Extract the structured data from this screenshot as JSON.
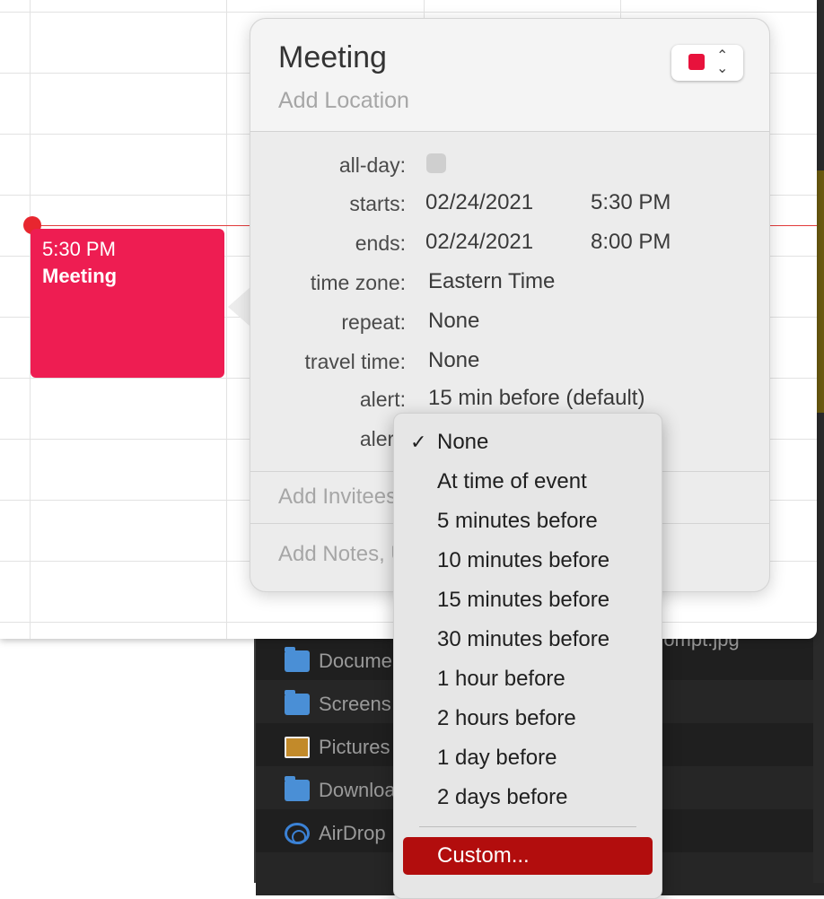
{
  "finder": {
    "sidebar": [
      {
        "label": "Docume",
        "icon": "folder-documents-icon"
      },
      {
        "label": "Screens",
        "icon": "folder-icon"
      },
      {
        "label": "Pictures",
        "icon": "pictures-icon"
      },
      {
        "label": "Downloa",
        "icon": "downloads-icon"
      },
      {
        "label": "AirDrop",
        "icon": "airdrop-icon"
      }
    ],
    "file_name": "rompt.jpg"
  },
  "calendar": {
    "event": {
      "time": "5:30 PM",
      "name": "Meeting",
      "color": "#ee1d52"
    }
  },
  "popover": {
    "title": "Meeting",
    "location_placeholder": "Add Location",
    "calendar_color": "#e8123c",
    "fields": {
      "allday_label": "all-day:",
      "starts_label": "starts:",
      "starts_date": "02/24/2021",
      "starts_time": "5:30 PM",
      "ends_label": "ends:",
      "ends_date": "02/24/2021",
      "ends_time": "8:00 PM",
      "timezone_label": "time zone:",
      "timezone_value": "Eastern Time",
      "repeat_label": "repeat:",
      "repeat_value": "None",
      "travel_label": "travel time:",
      "travel_value": "None",
      "alert_label": "alert:",
      "alert_value": "15 min before (default)",
      "alert2_label": "alert:"
    },
    "add_invitees": "Add Invitees",
    "add_notes": "Add Notes, URL, or Attachments"
  },
  "alert_menu": {
    "items": [
      {
        "label": "None",
        "checked": true
      },
      {
        "label": "At time of event"
      },
      {
        "label": "5 minutes before"
      },
      {
        "label": "10 minutes before"
      },
      {
        "label": "15 minutes before"
      },
      {
        "label": "30 minutes before"
      },
      {
        "label": "1 hour before"
      },
      {
        "label": "2 hours before"
      },
      {
        "label": "1 day before"
      },
      {
        "label": "2 days before"
      }
    ],
    "custom_label": "Custom...",
    "checkmark": "✓"
  }
}
